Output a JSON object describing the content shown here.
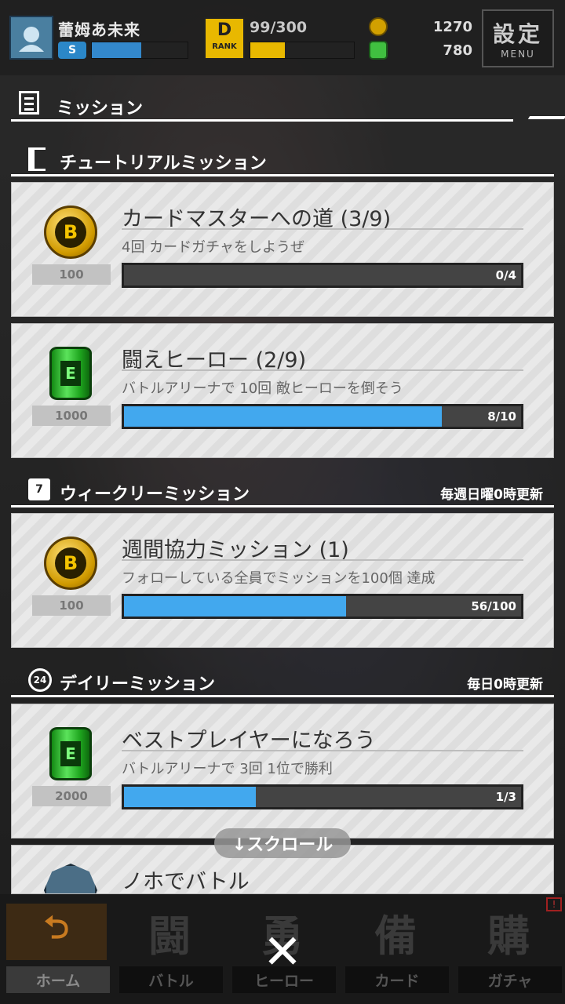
{
  "status": {
    "player_name": "蕾姆あ未来",
    "rank_letter": "S",
    "rank_icon_text": "D",
    "rank_icon_caption": "RANK",
    "rank_progress": "99/300",
    "coins": "1270",
    "oil": "780",
    "settings_label": "設定",
    "settings_sub": "MENU"
  },
  "page_title": "ミッション",
  "sections": [
    {
      "title": "チュートリアルミッション",
      "refresh": "",
      "missions": [
        {
          "title": "カードマスターへの道 (3/9)",
          "desc": "4回 カードガチャをしようぜ",
          "reward_type": "coin",
          "reward_amount": "100",
          "progress_label": "0/4",
          "progress": 0.0
        },
        {
          "title": "闘えヒーロー (2/9)",
          "desc": "バトルアリーナで 10回 敵ヒーローを倒そう",
          "reward_type": "oil",
          "reward_amount": "1000",
          "progress_label": "8/10",
          "progress": 0.8
        }
      ]
    },
    {
      "title": "ウィークリーミッション",
      "refresh": "毎週日曜0時更新",
      "missions": [
        {
          "title": "週間協力ミッション (1)",
          "desc": "フォローしている全員でミッションを100個 達成",
          "reward_type": "coin",
          "reward_amount": "100",
          "progress_label": "56/100",
          "progress": 0.56
        }
      ]
    },
    {
      "title": "デイリーミッション",
      "refresh": "毎日0時更新",
      "missions": [
        {
          "title": "ベストプレイヤーになろう",
          "desc": "バトルアリーナで 3回 1位で勝利",
          "reward_type": "oil",
          "reward_amount": "2000",
          "progress_label": "1/3",
          "progress": 0.333
        },
        {
          "title": "ノホでバトル",
          "desc": "",
          "reward_type": "gear",
          "reward_amount": "",
          "progress_label": "",
          "progress": 0
        }
      ]
    }
  ],
  "scroll_hint": "↓スクロール",
  "nav": [
    {
      "label": "ホーム",
      "icon": "home-icon"
    },
    {
      "label": "バトル",
      "icon": "battle-icon",
      "glyph": "闘"
    },
    {
      "label": "ヒーロー",
      "icon": "hero-icon",
      "glyph": "勇"
    },
    {
      "label": "カード",
      "icon": "card-icon",
      "glyph": "備"
    },
    {
      "label": "ガチャ",
      "icon": "gacha-icon",
      "glyph": "購",
      "badge": "!"
    }
  ],
  "colors": {
    "progress": "#42a8ee",
    "rank": "#e8b800",
    "name_gauge": "#3388cc"
  }
}
